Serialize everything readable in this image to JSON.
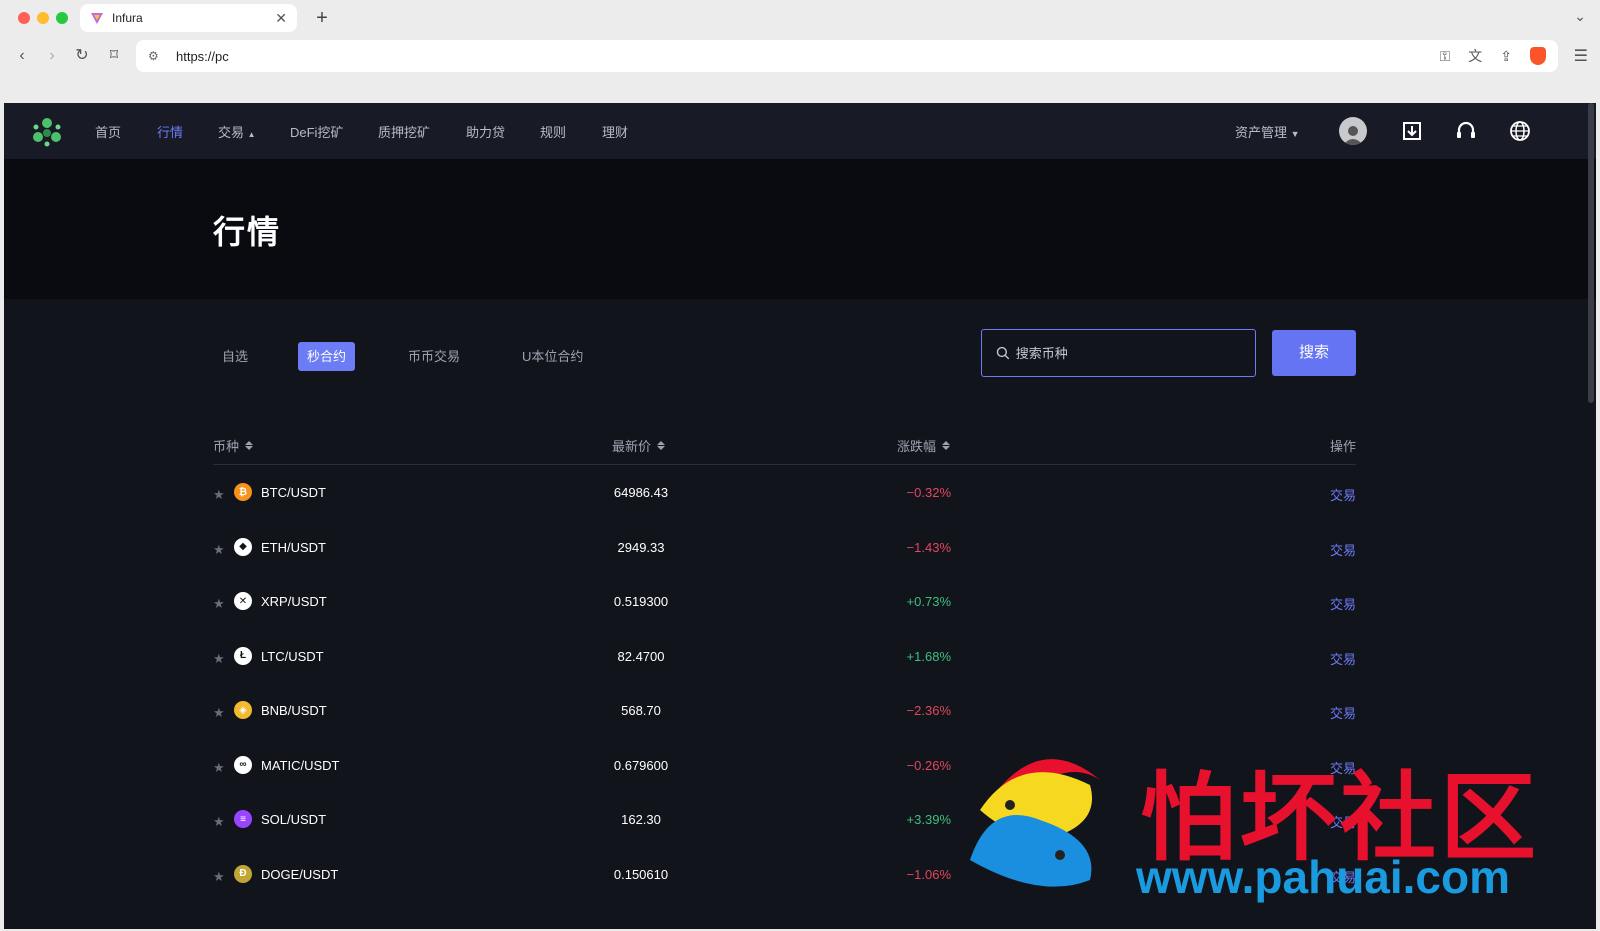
{
  "browser": {
    "tab_title": "Infura",
    "url": "https://pc",
    "new_tab": "+"
  },
  "nav": {
    "items": [
      "首页",
      "行情",
      "交易",
      "DeFi挖矿",
      "质押挖矿",
      "助力贷",
      "规则",
      "理财"
    ],
    "active": "行情",
    "asset_menu": "资产管理"
  },
  "hero": {
    "title": "行情"
  },
  "filters": {
    "tabs": [
      "自选",
      "秒合约",
      "币币交易",
      "U本位合约"
    ],
    "active": "秒合约"
  },
  "search": {
    "placeholder": "搜索币种",
    "button": "搜索"
  },
  "table": {
    "headers": {
      "coin": "币种",
      "price": "最新价",
      "change": "涨跌幅",
      "action": "操作"
    },
    "rows": [
      {
        "pair": "BTC/USDT",
        "price": "64986.43",
        "change": "−0.32%",
        "dir": "down",
        "action": "交易",
        "icon": "bitcoin-icon",
        "color": "#f7931a"
      },
      {
        "pair": "ETH/USDT",
        "price": "2949.33",
        "change": "−1.43%",
        "dir": "down",
        "action": "交易",
        "icon": "ethereum-icon",
        "color": "#ffffff"
      },
      {
        "pair": "XRP/USDT",
        "price": "0.519300",
        "change": "+0.73%",
        "dir": "up",
        "action": "交易",
        "icon": "xrp-icon",
        "color": "#ffffff"
      },
      {
        "pair": "LTC/USDT",
        "price": "82.4700",
        "change": "+1.68%",
        "dir": "up",
        "action": "交易",
        "icon": "litecoin-icon",
        "color": "#ffffff"
      },
      {
        "pair": "BNB/USDT",
        "price": "568.70",
        "change": "−2.36%",
        "dir": "down",
        "action": "交易",
        "icon": "bnb-icon",
        "color": "#f3ba2f"
      },
      {
        "pair": "MATIC/USDT",
        "price": "0.679600",
        "change": "−0.26%",
        "dir": "down",
        "action": "交易",
        "icon": "matic-icon",
        "color": "#ffffff"
      },
      {
        "pair": "SOL/USDT",
        "price": "162.30",
        "change": "+3.39%",
        "dir": "up",
        "action": "交易",
        "icon": "solana-icon",
        "color": "#9945ff"
      },
      {
        "pair": "DOGE/USDT",
        "price": "0.150610",
        "change": "−1.06%",
        "dir": "down",
        "action": "交易",
        "icon": "doge-icon",
        "color": "#c2a633"
      }
    ]
  },
  "colors": {
    "accent": "#6c7cf5",
    "down": "#e0475a",
    "up": "#3fbf7f"
  },
  "watermark": {
    "text": "怕坏社区",
    "url": "www.pahuai.com"
  }
}
